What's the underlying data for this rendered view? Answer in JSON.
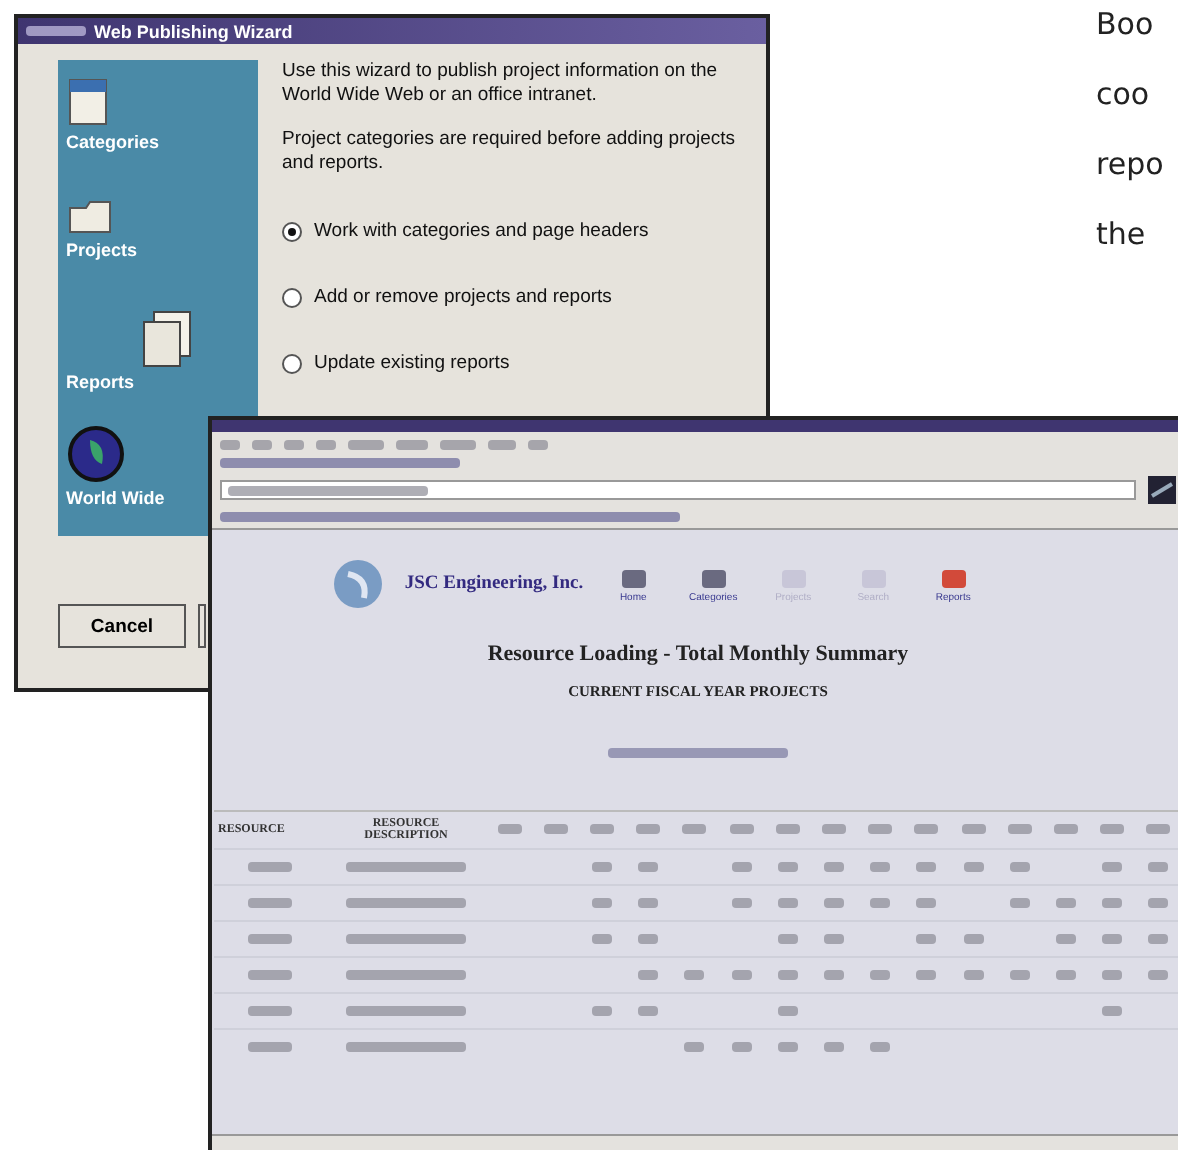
{
  "wizard": {
    "title": "Web Publishing Wizard",
    "steps": [
      {
        "label": "Categories",
        "kind": "categories"
      },
      {
        "label": "Projects",
        "kind": "projects"
      },
      {
        "label": "Reports",
        "kind": "reports"
      },
      {
        "label": "World Wide",
        "kind": "globe"
      }
    ],
    "intro": "Use this wizard to publish project information on the World Wide Web or an office intranet.",
    "note": "Project categories are required before adding projects and reports.",
    "options": [
      {
        "label": "Work with categories and page headers",
        "selected": true
      },
      {
        "label": "Add or remove projects and reports",
        "selected": false
      },
      {
        "label": "Update existing reports",
        "selected": false
      }
    ],
    "buttons": [
      "Cancel"
    ]
  },
  "browser": {
    "company": "JSC Engineering, Inc.",
    "nav": [
      {
        "label": "Home",
        "disabled": false
      },
      {
        "label": "Categories",
        "disabled": false
      },
      {
        "label": "Projects",
        "disabled": true
      },
      {
        "label": "Search",
        "disabled": true
      },
      {
        "label": "Reports",
        "disabled": false
      }
    ],
    "title": "Resource Loading - Total Monthly Summary",
    "subtitle": "CURRENT FISCAL YEAR PROJECTS",
    "table": {
      "columns": [
        "RESOURCE",
        "RESOURCE DESCRIPTION"
      ]
    }
  },
  "article_lines": [
    "Boo",
    "coo",
    "repo",
    "the"
  ]
}
